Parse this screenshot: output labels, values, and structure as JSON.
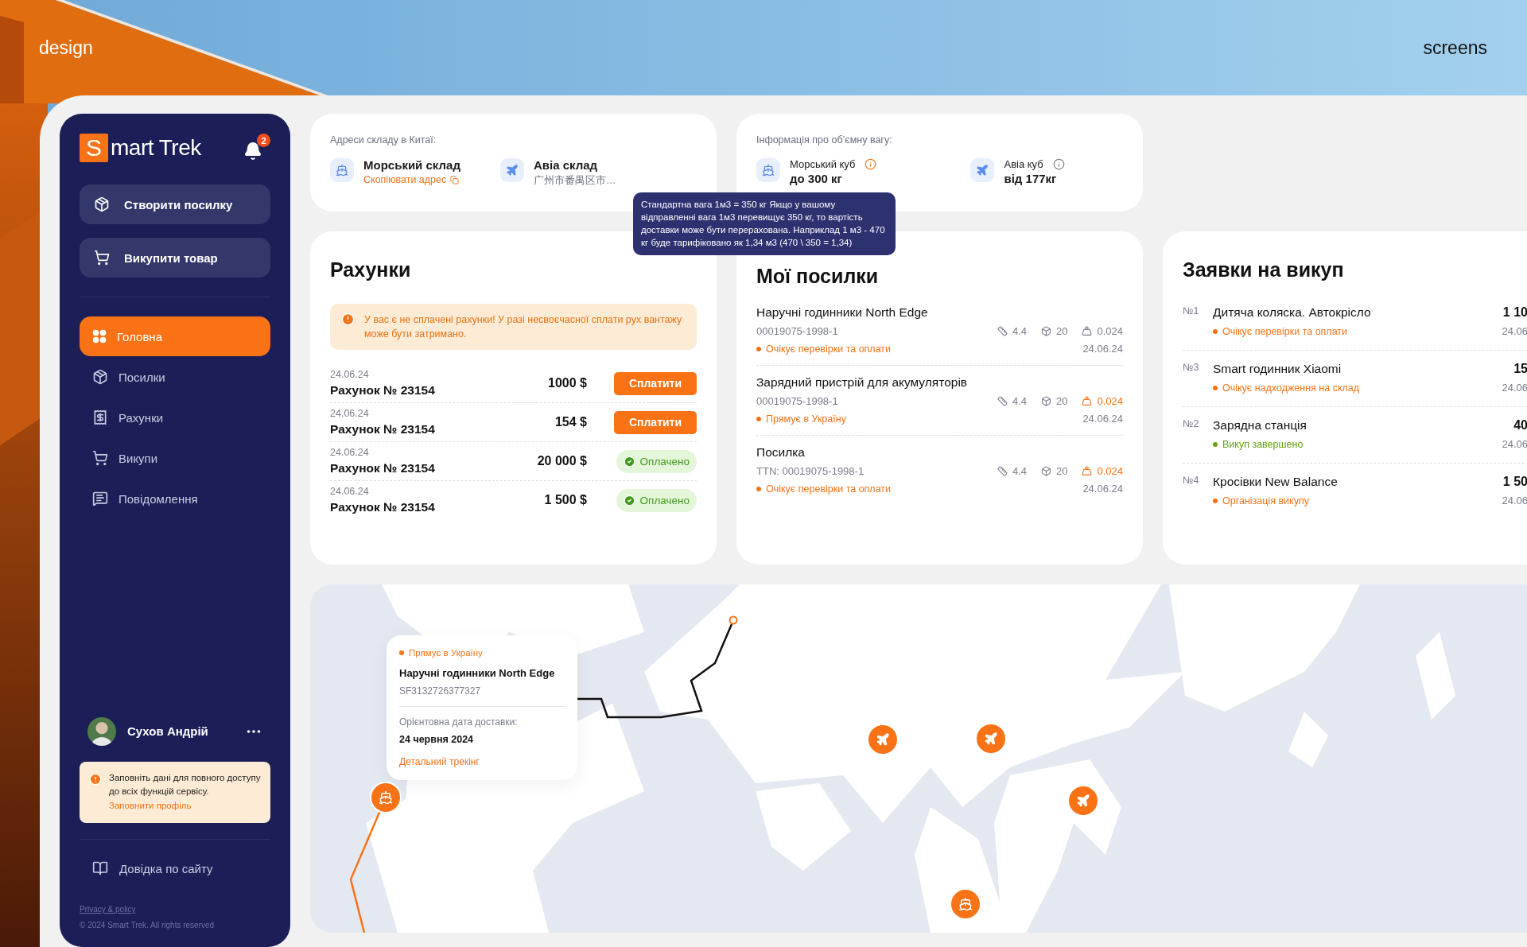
{
  "backdrop": {
    "left_label": "design",
    "right_label": "screens"
  },
  "sidebar": {
    "logo": {
      "initial": "S",
      "rest": "mart Trek"
    },
    "notifications": "2",
    "actions": [
      "Створити посилку",
      "Викупити товар"
    ],
    "nav": [
      {
        "label": "Головна",
        "selected": true
      },
      {
        "label": "Посилки",
        "selected": false
      },
      {
        "label": "Рахунки",
        "selected": false
      },
      {
        "label": "Викупи",
        "selected": false
      },
      {
        "label": "Повідомлення",
        "selected": false
      }
    ],
    "user": {
      "name": "Сухов Андрій"
    },
    "notice": {
      "text": "Заповніть дані для повного доступу до всіх функцій сервісу.",
      "link": "Заповнити профіль"
    },
    "help": "Довідка по сайту",
    "privacy": "Privacy & policy",
    "copyright": "© 2024 Smart Trek. All rights reserved"
  },
  "warehouses": {
    "title": "Адреси складу в Китаї:",
    "items": [
      {
        "name": "Морський склад",
        "detail": "Скопіювати адрес",
        "kind": "link"
      },
      {
        "name": "Авіа склад",
        "detail": "广州市番禺区市…",
        "kind": "text"
      }
    ]
  },
  "volume": {
    "title": "Інформація про об’ємну вагу:",
    "items": [
      {
        "name": "Морський куб",
        "value": "до 300 кг",
        "info_active": true
      },
      {
        "name": "Авіа куб",
        "value": "від 177кг",
        "info_active": false
      }
    ],
    "tooltip": "Стандартна вага 1м3 = 350 кг Якщо у вашому відправленні вага 1м3 перевищує 350 кг, то вартість доставки може бути перерахована. Наприклад 1 м3 - 470 кг буде тарифіковано як 1,34 м3 (470 \\ 350 = 1,34)"
  },
  "bills": {
    "title": "Рахунки",
    "alert": "У вас є не сплачені  рахунки! У разі несвоєчасної сплати рух вантажу може бути затримано.",
    "rows": [
      {
        "date": "24.06.24",
        "name": "Рахунок № 23154",
        "amount": "1000 $",
        "kind": "unpaid",
        "action": "Сплатити"
      },
      {
        "date": "24.06.24",
        "name": "Рахунок № 23154",
        "amount": "154 $",
        "kind": "unpaid",
        "action": "Сплатити"
      },
      {
        "date": "24.06.24",
        "name": "Рахунок № 23154",
        "amount": "20 000 $",
        "kind": "paid",
        "action": "Оплачено"
      },
      {
        "date": "24.06.24",
        "name": "Рахунок № 23154",
        "amount": "1 500 $",
        "kind": "paid",
        "action": "Оплачено"
      }
    ]
  },
  "parcels": {
    "title": "Мої посилки",
    "items": [
      {
        "name": "Наручні годинники North Edge",
        "code": "00019075-1998-1",
        "status": "Очікує перевірки та оплати",
        "size": "4.4",
        "places": "20",
        "weight": "0.024",
        "weight_alert": false,
        "date": "24.06.24"
      },
      {
        "name": "Зарядний пристрій для акумуляторів",
        "code": "00019075-1998-1",
        "status": "Прямує в Україну",
        "size": "4.4",
        "places": "20",
        "weight": "0.024",
        "weight_alert": true,
        "date": "24.06.24"
      },
      {
        "name": "Посилка",
        "code": "TTN: 00019075-1998-1",
        "status": "Очікує перевірки та оплати",
        "size": "4.4",
        "places": "20",
        "weight": "0.024",
        "weight_alert": true,
        "date": "24.06.24"
      }
    ]
  },
  "requests": {
    "title": "Заявки на викуп",
    "items": [
      {
        "number": "№1",
        "name": "Дитяча коляска. Автокрісло",
        "status": "Очікує перевірки та оплати",
        "color": "#f97316",
        "amount": "1 10",
        "date": "24.06"
      },
      {
        "number": "№3",
        "name": "Smart годинник Xiaomi",
        "status": "Очікує надходження на склад",
        "color": "#f97316",
        "amount": "15",
        "date": "24.06"
      },
      {
        "number": "№2",
        "name": "Зарядна станція",
        "status": "Викуп завершено",
        "color": "#65a30d",
        "amount": "40",
        "date": "24.06"
      },
      {
        "number": "№4",
        "name": "Кросівки New Balance",
        "status": "Організація викупу",
        "color": "#f97316",
        "amount": "1 50",
        "date": "24.06"
      }
    ]
  },
  "map": {
    "popup": {
      "status": "Прямує в Україну",
      "name": "Наручні годинники North Edge",
      "code": "SF3132726377327",
      "eta_label": "Орієнтовна дата доставки:",
      "eta": "24 червня 2024",
      "link": "Детальний трекінг"
    },
    "markers": [
      {
        "kind": "plane"
      },
      {
        "kind": "plane"
      },
      {
        "kind": "plane"
      },
      {
        "kind": "ship"
      },
      {
        "kind": "ship"
      }
    ]
  }
}
